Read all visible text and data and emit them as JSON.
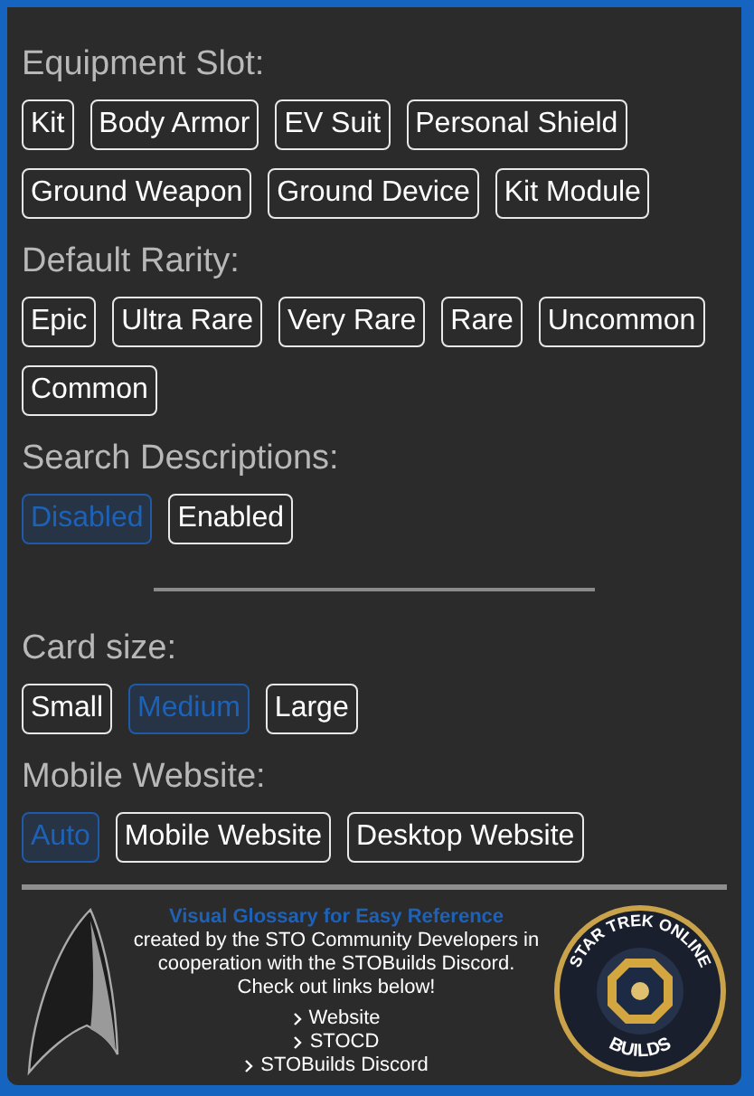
{
  "sections": [
    {
      "kind": "options",
      "title": "Equipment Slot:",
      "options": [
        {
          "label": "Kit",
          "selected": false
        },
        {
          "label": "Body Armor",
          "selected": false
        },
        {
          "label": "EV Suit",
          "selected": false
        },
        {
          "label": "Personal Shield",
          "selected": false
        },
        {
          "label": "Ground Weapon",
          "selected": false
        },
        {
          "label": "Ground Device",
          "selected": false
        },
        {
          "label": "Kit Module",
          "selected": false
        }
      ]
    },
    {
      "kind": "options",
      "title": "Default Rarity:",
      "options": [
        {
          "label": "Epic",
          "selected": false
        },
        {
          "label": "Ultra Rare",
          "selected": false
        },
        {
          "label": "Very Rare",
          "selected": false
        },
        {
          "label": "Rare",
          "selected": false
        },
        {
          "label": "Uncommon",
          "selected": false
        },
        {
          "label": "Common",
          "selected": false
        }
      ]
    },
    {
      "kind": "options",
      "title": "Search Descriptions:",
      "options": [
        {
          "label": "Disabled",
          "selected": true
        },
        {
          "label": "Enabled",
          "selected": false
        }
      ]
    },
    {
      "kind": "divider"
    },
    {
      "kind": "options",
      "title": "Card size:",
      "options": [
        {
          "label": "Small",
          "selected": false
        },
        {
          "label": "Medium",
          "selected": true
        },
        {
          "label": "Large",
          "selected": false
        }
      ]
    },
    {
      "kind": "options",
      "title": "Mobile Website:",
      "options": [
        {
          "label": "Auto",
          "selected": true
        },
        {
          "label": "Mobile Website",
          "selected": false
        },
        {
          "label": "Desktop Website",
          "selected": false
        }
      ]
    }
  ],
  "footer": {
    "title": "Visual Glossary for Easy Reference",
    "description": [
      "created by the STO Community Developers in cooperation with the STOBuilds Discord.",
      "Check out links below!"
    ],
    "links": [
      "Website",
      "STOCD",
      "STOBuilds Discord"
    ],
    "badge": {
      "top_text": "STAR TREK ONLINE",
      "bottom_text": "BUILDS"
    }
  }
}
